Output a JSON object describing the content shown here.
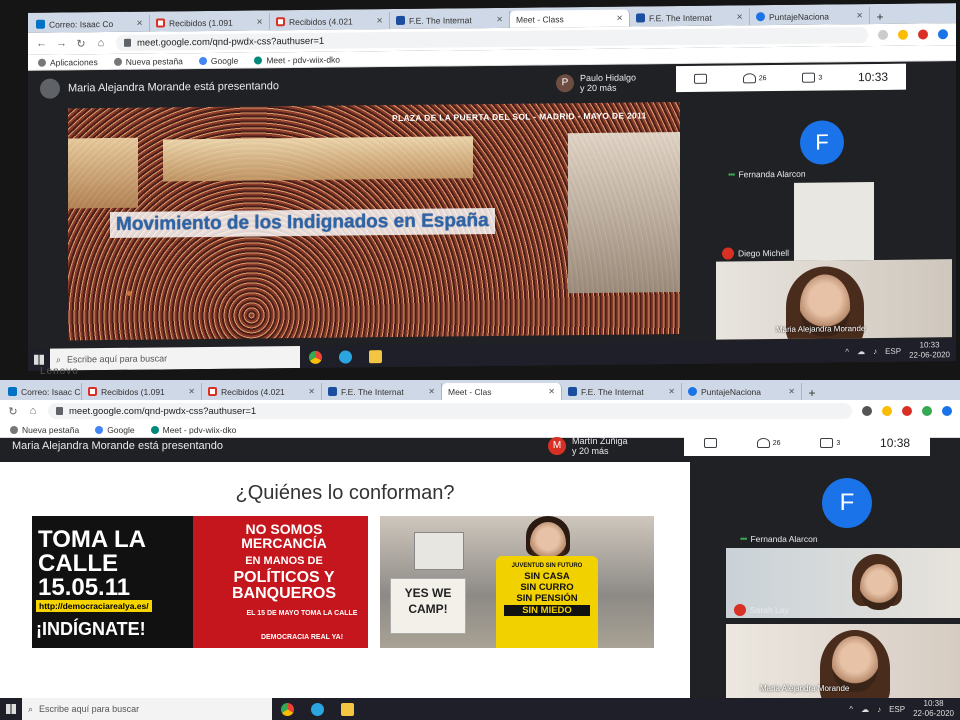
{
  "top": {
    "tabs": [
      {
        "label": "Correo: Isaac Co",
        "icon": "mail-icon"
      },
      {
        "label": "Recibidos (1.091",
        "icon": "gmail-icon"
      },
      {
        "label": "Recibidos (4.021",
        "icon": "gmail-icon"
      },
      {
        "label": "F.E. The Internat",
        "icon": "fe-icon"
      },
      {
        "label": "Meet - Class",
        "icon": "meet-icon"
      },
      {
        "label": "F.E. The Internat",
        "icon": "fe-icon"
      },
      {
        "label": "PuntajeNaciona",
        "icon": "pn-icon"
      }
    ],
    "url": "meet.google.com/qnd-pwdx-css?authuser=1",
    "bookmarks": [
      "Aplicaciones",
      "Nueva pestaña",
      "Google",
      "Meet - pdv-wiix-dko"
    ],
    "presenting": "Maria Alejandra Morande está presentando",
    "speaker_name": "Paulo Hidalgo",
    "speaker_more": "y 20 más",
    "speaker_initial": "P",
    "people_count": "26",
    "chat_count": "3",
    "time": "10:33",
    "slide_caption": "PLAZA DE LA PUERTA DEL SOL - MADRID - MAYO DE 2011",
    "slide_title": "Movimiento de los Indignados en España",
    "self_initial": "F",
    "participants": [
      "Fernanda Alarcon",
      "Diego Michell",
      "Maria Alejandra Morande"
    ],
    "taskbar_search": "Escribe aquí para buscar",
    "lang": "ESP",
    "clock_time": "10:33",
    "clock_date": "22-06-2020"
  },
  "bottom": {
    "tabs": [
      {
        "label": "Correo: Isaac Co",
        "icon": "mail-icon"
      },
      {
        "label": "Recibidos (1.091",
        "icon": "gmail-icon"
      },
      {
        "label": "Recibidos (4.021",
        "icon": "gmail-icon"
      },
      {
        "label": "F.E. The Internat",
        "icon": "fe-icon"
      },
      {
        "label": "Meet - Clas",
        "icon": "meet-icon"
      },
      {
        "label": "F.E. The Internat",
        "icon": "fe-icon"
      },
      {
        "label": "PuntajeNaciona",
        "icon": "pn-icon"
      }
    ],
    "url": "meet.google.com/qnd-pwdx-css?authuser=1",
    "bookmarks": [
      "Nueva pestaña",
      "Google",
      "Meet - pdv-wiix-dko"
    ],
    "presenting": "Maria Alejandra Morande está presentando",
    "speaker_name": "Martín Zuñiga",
    "speaker_more": "y 20 más",
    "speaker_initial": "M",
    "people_count": "26",
    "chat_count": "3",
    "time": "10:38",
    "slide_heading": "¿Quiénes lo conforman?",
    "poster": {
      "left_text": "TOMA LA CALLE 15.05.11",
      "url": "http://democraciarealya.es/",
      "indignate": "¡INDÍGNATE!",
      "right_top": "NO SOMOS MERCANCÍA",
      "right_mid": "EN MANOS DE",
      "right_big": "POLÍTICOS Y BANQUEROS",
      "date_line": "EL 15 DE MAYO TOMA LA CALLE",
      "footer": "DEMOCRACIA REAL YA!"
    },
    "shirt_lines": [
      "JUVENTUD SIN FUTURO",
      "SIN CASA",
      "SIN CURRO",
      "SIN PENSIÓN",
      "SIN MIEDO"
    ],
    "sign_text": "YES WE CAMP!",
    "self_initial": "F",
    "participants": [
      "Fernanda Alarcon",
      "Sarah Lay",
      "Maria Alejandra Morande"
    ],
    "taskbar_search": "Escribe aquí para buscar",
    "lang": "ESP",
    "clock_time": "10:38",
    "clock_date": "22-06-2020"
  },
  "colors": {
    "meet_bg": "#202124",
    "accent_blue": "#1a73e8",
    "mic_off_red": "#d93025",
    "title_blue": "#2d64a8",
    "poster_red": "#c4161c",
    "shirt_yellow": "#f2d100"
  }
}
